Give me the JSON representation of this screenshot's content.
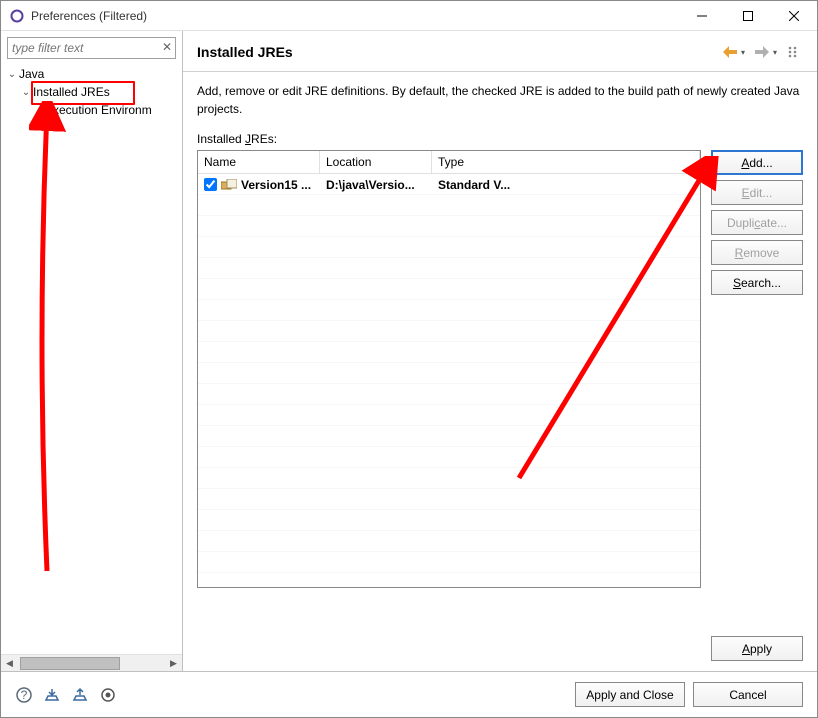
{
  "window": {
    "title": "Preferences (Filtered)"
  },
  "filter": {
    "placeholder": "type filter text"
  },
  "tree": {
    "items": [
      {
        "label": "Java"
      },
      {
        "label": "Installed JREs"
      },
      {
        "label": "Execution Environm"
      }
    ]
  },
  "page": {
    "title": "Installed JREs",
    "description": "Add, remove or edit JRE definitions. By default, the checked JRE is added to the build path of newly created Java projects.",
    "tableLabelPrefix": "Installed ",
    "tableLabelMn": "J",
    "tableLabelSuffix": "REs:",
    "columns": {
      "name": "Name",
      "location": "Location",
      "type": "Type"
    },
    "rows": [
      {
        "checked": true,
        "name": "Version15 ...",
        "location": "D:\\java\\Versio...",
        "type": "Standard V..."
      }
    ],
    "buttons": {
      "add": {
        "mn": "A",
        "rest": "dd..."
      },
      "edit": {
        "mn": "E",
        "rest": "dit..."
      },
      "duplicate": {
        "pre": "Dupli",
        "mn": "c",
        "rest": "ate..."
      },
      "remove": {
        "mn": "R",
        "rest": "emove"
      },
      "search": {
        "mn": "S",
        "rest": "earch..."
      },
      "apply": {
        "mn": "A",
        "rest": "pply"
      }
    }
  },
  "footer": {
    "applyClose": "Apply and Close",
    "cancel": "Cancel"
  }
}
